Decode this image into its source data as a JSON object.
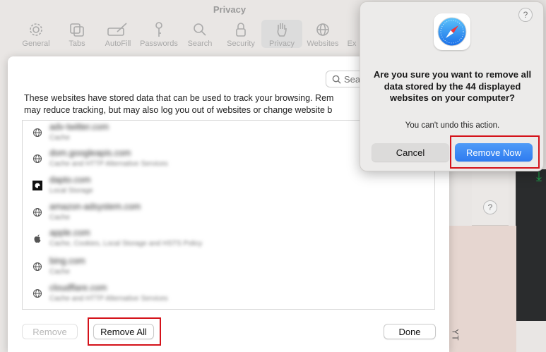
{
  "window": {
    "title": "Privacy"
  },
  "toolbar": {
    "items": [
      {
        "label": "General",
        "icon": "gear-icon"
      },
      {
        "label": "Tabs",
        "icon": "tabs-icon"
      },
      {
        "label": "AutoFill",
        "icon": "pencil-icon"
      },
      {
        "label": "Passwords",
        "icon": "key-icon"
      },
      {
        "label": "Search",
        "icon": "magnifier-icon"
      },
      {
        "label": "Security",
        "icon": "lock-icon"
      },
      {
        "label": "Privacy",
        "icon": "hand-icon",
        "active": true
      },
      {
        "label": "Websites",
        "icon": "globe-icon"
      },
      {
        "label": "Ex",
        "icon": "extensions-icon"
      }
    ]
  },
  "sheet": {
    "search_placeholder": "Search",
    "description_line1": "These websites have stored data that can be used to track your browsing. Rem",
    "description_line2": "may reduce tracking, but may also log you out of websites or change website b",
    "websites": [
      {
        "name": "adv-twitter.com",
        "detail": "Cache",
        "icon": "globe-icon"
      },
      {
        "name": "dom.googleapis.com",
        "detail": "Cache and HTTP Alternative Services",
        "icon": "globe-icon"
      },
      {
        "name": "dapto.com",
        "detail": "Local Storage",
        "icon": "site-logo-icon"
      },
      {
        "name": "amazon-adsystem.com",
        "detail": "Cache",
        "icon": "globe-icon"
      },
      {
        "name": "apple.com",
        "detail": "Cache, Cookies, Local Storage and HSTS Policy",
        "icon": "apple-icon"
      },
      {
        "name": "bing.com",
        "detail": "Cache",
        "icon": "globe-icon"
      },
      {
        "name": "cloudflare.com",
        "detail": "Cache and HTTP Alternative Services",
        "icon": "globe-icon"
      }
    ],
    "remove_label": "Remove",
    "remove_all_label": "Remove All",
    "done_label": "Done"
  },
  "alert": {
    "title": "Are you sure you want to remove all data stored by the 44 displayed websites on your computer?",
    "message": "You can't undo this action.",
    "cancel_label": "Cancel",
    "confirm_label": "Remove Now",
    "help": "?"
  },
  "background": {
    "help": "?",
    "side_text": "YT"
  },
  "colors": {
    "accent": "#2e7bf0",
    "highlight": "#d4121a"
  }
}
